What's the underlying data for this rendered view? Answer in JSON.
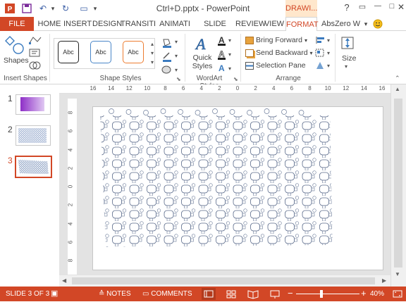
{
  "window": {
    "title": "Ctrl+D.pptx - PowerPoint",
    "context_tab_group": "DRAWI...",
    "help": "?",
    "restore": "▭",
    "minimize": "—",
    "maximize": "□",
    "close": "✕"
  },
  "quick_access": {
    "undo": "↶",
    "redo": "↻",
    "present": "▭",
    "customize": "▾"
  },
  "tabs": {
    "file": "FILE",
    "home": "HOME",
    "insert": "INSERT",
    "design": "DESIGN",
    "transitions": "TRANSITI",
    "animations": "ANIMATI",
    "slideshow": "SLIDE SHO",
    "review": "REVIEW",
    "view": "VIEW",
    "format": "FORMAT",
    "user": "AbsZero W",
    "user_caret": "▾"
  },
  "ribbon": {
    "insert_shapes": {
      "shapes_label": "Shapes",
      "group_label": "Insert Shapes"
    },
    "shape_styles": {
      "style1": "Abc",
      "style2": "Abc",
      "style3": "Abc",
      "group_label": "Shape Styles"
    },
    "wordart": {
      "quick_styles": "Quick Styles",
      "group_label": "WordArt Styles"
    },
    "arrange": {
      "bring_forward": "Bring Forward",
      "send_backward": "Send Backward",
      "selection_pane": "Selection Pane",
      "group_label": "Arrange"
    },
    "size": {
      "label": "Size"
    }
  },
  "thumbnails": [
    {
      "number": "1"
    },
    {
      "number": "2"
    },
    {
      "number": "3"
    }
  ],
  "ruler": {
    "horizontal_ticks": [
      "16",
      "14",
      "12",
      "10",
      "8",
      "6",
      "4",
      "2",
      "0",
      "2",
      "4",
      "6",
      "8",
      "10",
      "12",
      "14",
      "16"
    ],
    "vertical_ticks": [
      "8",
      "6",
      "4",
      "2",
      "0",
      "2",
      "4",
      "6",
      "8"
    ]
  },
  "status": {
    "slide": "SLIDE 3 OF 3",
    "notes": "NOTES",
    "comments": "COMMENTS",
    "zoom": "40%",
    "zoom_fraction": 0.4
  },
  "colors": {
    "accent": "#d24726",
    "ribbon_bg": "#ffffff",
    "status_bg": "#d24726"
  }
}
